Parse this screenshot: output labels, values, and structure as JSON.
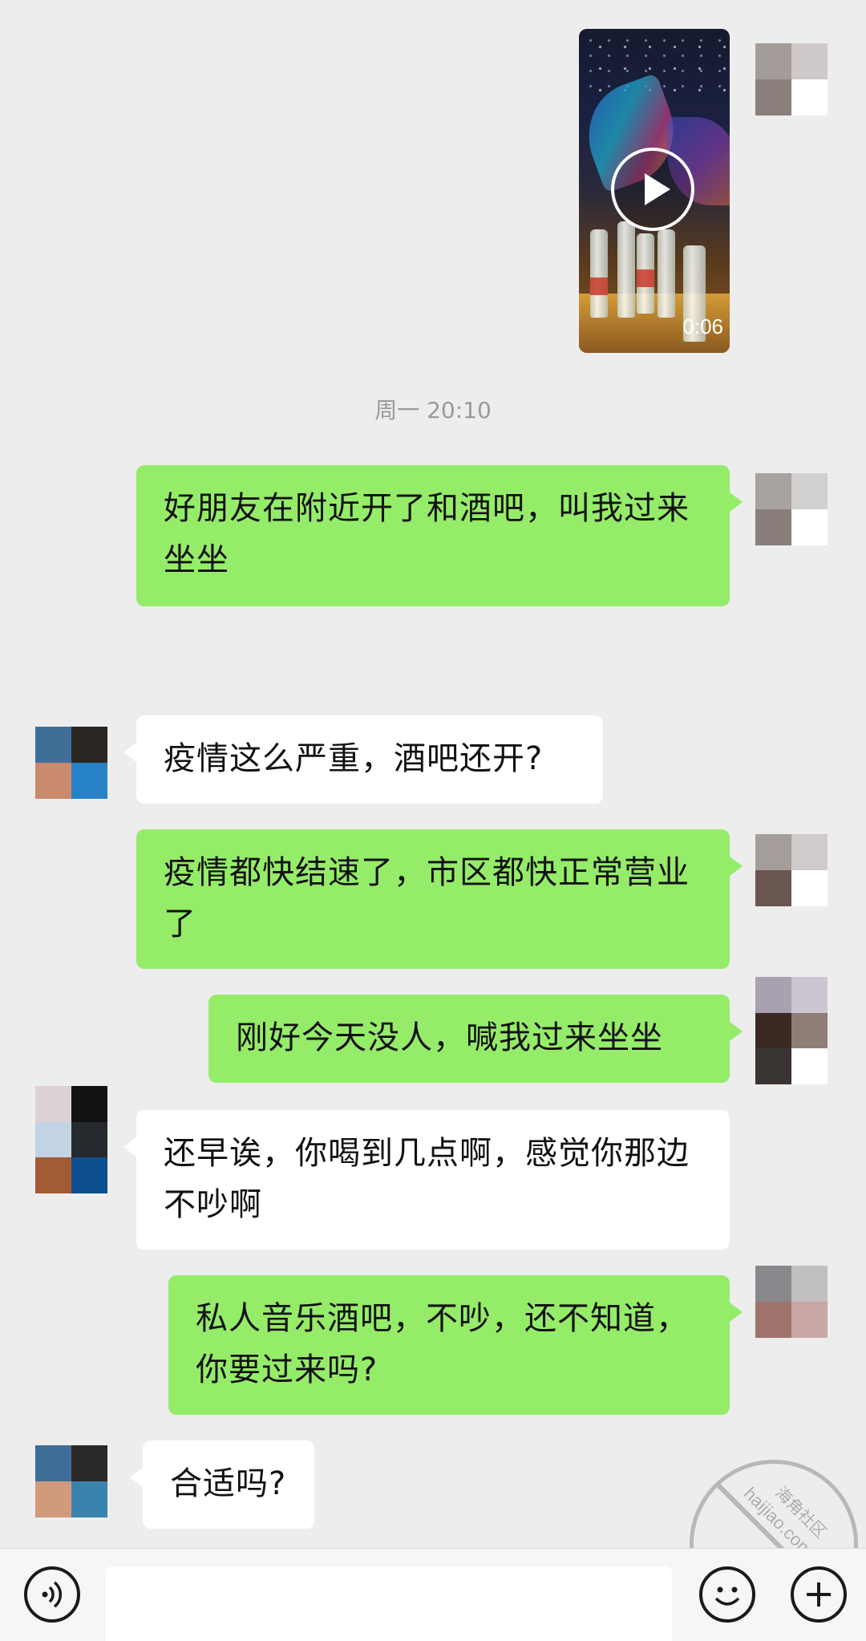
{
  "video_message": {
    "duration": "0:06"
  },
  "timestamp": "周一 20:10",
  "messages": [
    {
      "sender": "me",
      "text": "好朋友在附近开了和酒吧，叫我过来坐坐"
    },
    {
      "sender": "other",
      "text": "疫情这么严重，酒吧还开?"
    },
    {
      "sender": "me",
      "text": "疫情都快结速了，市区都快正常营业了"
    },
    {
      "sender": "me",
      "text": "刚好今天没人，喊我过来坐坐"
    },
    {
      "sender": "other",
      "text": "还早诶，你喝到几点啊，感觉你那边不吵啊"
    },
    {
      "sender": "me",
      "text": "私人音乐酒吧，不吵，还不知道，你要过来吗?"
    },
    {
      "sender": "other",
      "text": "合适吗?"
    }
  ],
  "watermark": {
    "text": "haijiao.com",
    "cn": "海角社区"
  },
  "icons": {
    "voice": "voice-icon",
    "emoji": "emoji-icon",
    "plus": "plus-icon",
    "play": "play-icon"
  },
  "colors": {
    "background": "#ededed",
    "my_bubble": "#95ec69",
    "other_bubble": "#ffffff"
  }
}
